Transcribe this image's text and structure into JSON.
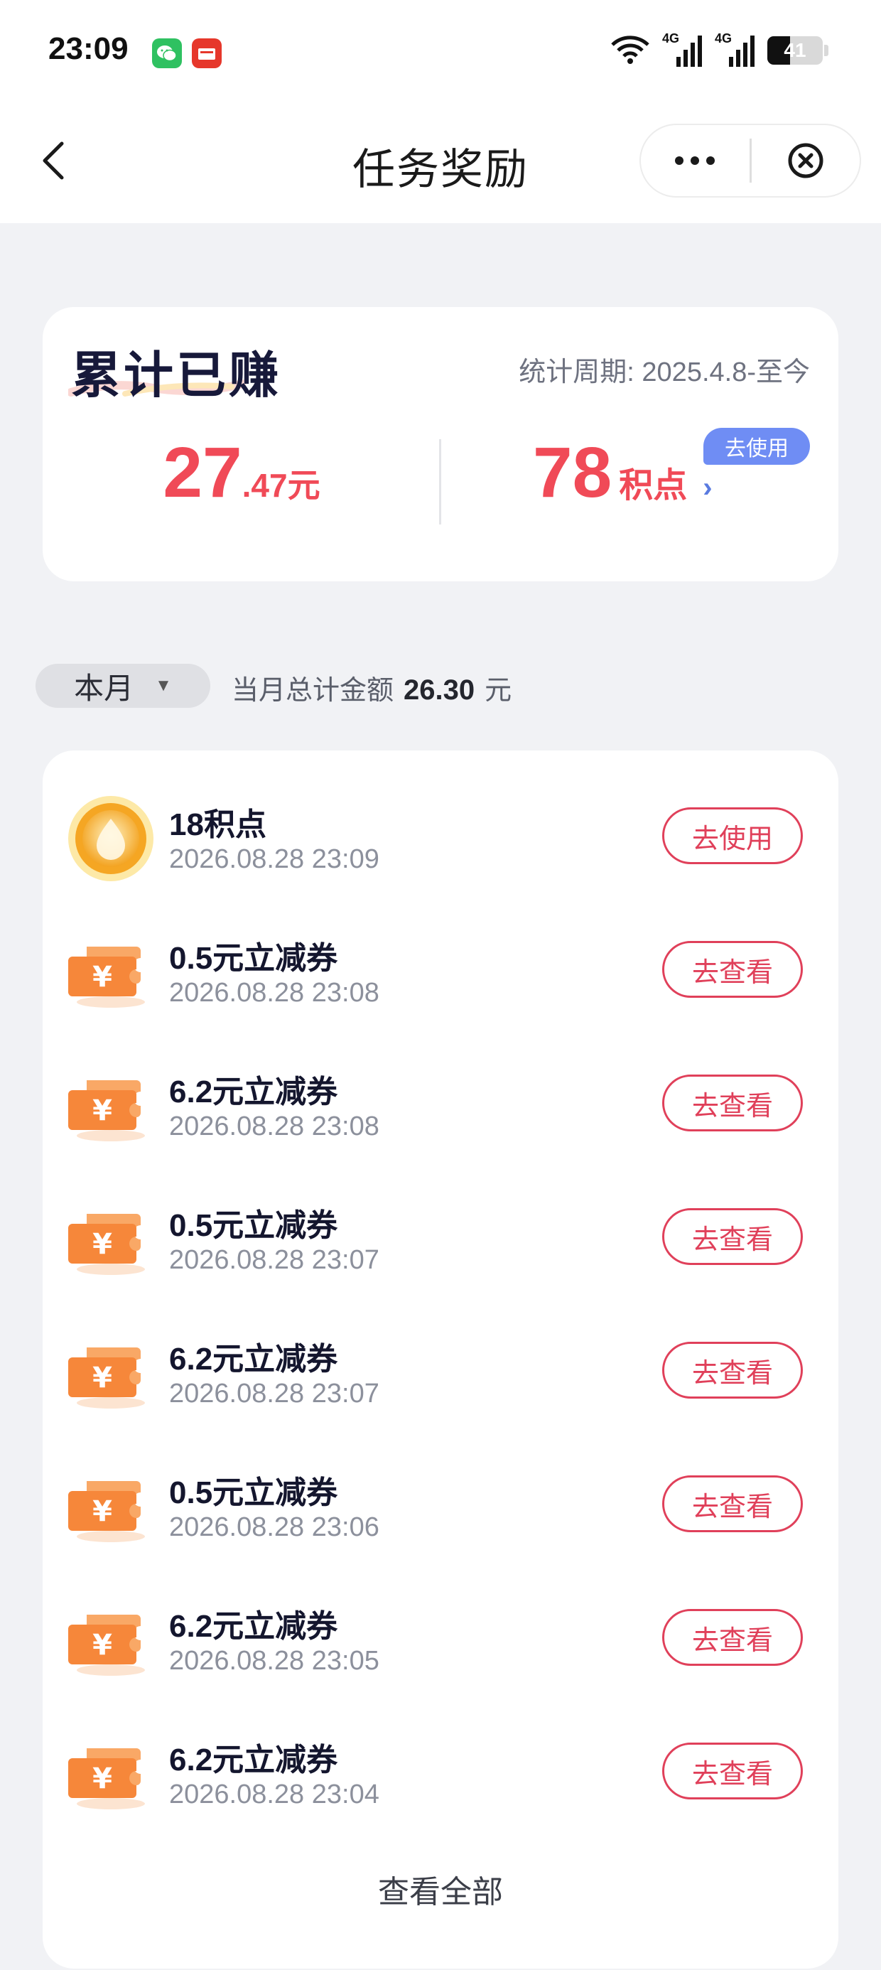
{
  "status_bar": {
    "time": "23:09",
    "network_1": "4G",
    "network_2": "4G",
    "battery": "41",
    "battery_level": 0.41
  },
  "nav": {
    "title": "任务奖励"
  },
  "summary": {
    "title": "累计已赚",
    "period": "统计周期: 2025.4.8-至今",
    "money_int": "27",
    "money_dec": ".47",
    "money_unit": "元",
    "points_value": "78",
    "points_unit": "积点",
    "points_chevron": "›",
    "use_badge": "去使用"
  },
  "filter": {
    "month": "本月",
    "arrow": "▼",
    "total_label": "当月总计金额",
    "total_amount": "26.30",
    "total_unit": "元"
  },
  "records": [
    {
      "icon": "coin-icon",
      "name": "18积点",
      "time": "2026.08.28 23:09",
      "action": "去使用"
    },
    {
      "icon": "coupon-icon",
      "name": "0.5元立减券",
      "time": "2026.08.28 23:08",
      "action": "去查看"
    },
    {
      "icon": "coupon-icon",
      "name": "6.2元立减券",
      "time": "2026.08.28 23:08",
      "action": "去查看"
    },
    {
      "icon": "coupon-icon",
      "name": "0.5元立减券",
      "time": "2026.08.28 23:07",
      "action": "去查看"
    },
    {
      "icon": "coupon-icon",
      "name": "6.2元立减券",
      "time": "2026.08.28 23:07",
      "action": "去查看"
    },
    {
      "icon": "coupon-icon",
      "name": "0.5元立减券",
      "time": "2026.08.28 23:06",
      "action": "去查看"
    },
    {
      "icon": "coupon-icon",
      "name": "6.2元立减券",
      "time": "2026.08.28 23:05",
      "action": "去查看"
    },
    {
      "icon": "coupon-icon",
      "name": "6.2元立减券",
      "time": "2026.08.28 23:04",
      "action": "去查看"
    }
  ],
  "view_all": "查看全部",
  "colors": {
    "accent_red": "#f04a57",
    "button_red": "#e0405a",
    "badge_blue": "#6f8df4",
    "coupon_orange": "#f6873a",
    "coin_gold": "#f5b63a"
  }
}
